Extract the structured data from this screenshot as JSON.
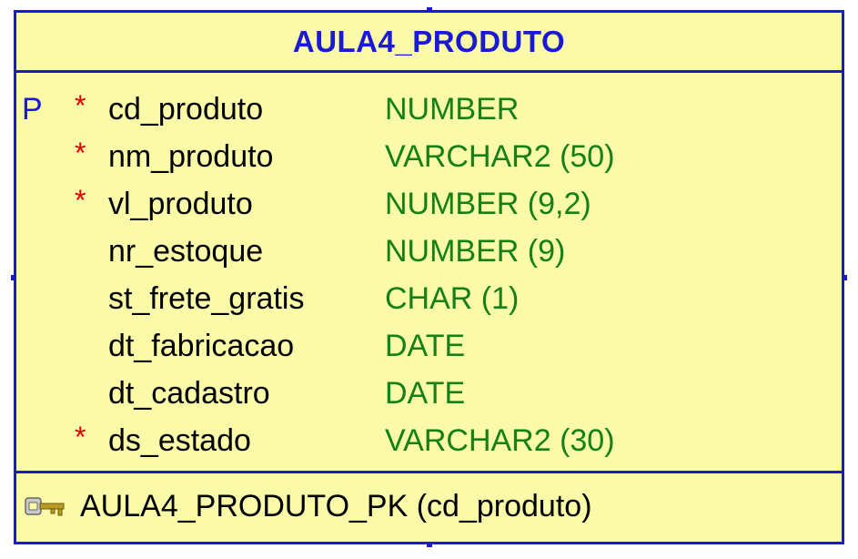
{
  "entity": {
    "name": "AULA4_PRODUTO",
    "columns": [
      {
        "pk": "P",
        "mandatory": "*",
        "name": "cd_produto",
        "type": "NUMBER"
      },
      {
        "pk": "",
        "mandatory": "*",
        "name": "nm_produto",
        "type": "VARCHAR2 (50)"
      },
      {
        "pk": "",
        "mandatory": "*",
        "name": "vl_produto",
        "type": "NUMBER (9,2)"
      },
      {
        "pk": "",
        "mandatory": "",
        "name": "nr_estoque",
        "type": "NUMBER (9)"
      },
      {
        "pk": "",
        "mandatory": "",
        "name": "st_frete_gratis",
        "type": "CHAR (1)"
      },
      {
        "pk": "",
        "mandatory": "",
        "name": "dt_fabricacao",
        "type": "DATE"
      },
      {
        "pk": "",
        "mandatory": "",
        "name": "dt_cadastro",
        "type": "DATE"
      },
      {
        "pk": "",
        "mandatory": "*",
        "name": "ds_estado",
        "type": "VARCHAR2 (30)"
      }
    ],
    "key": {
      "icon": "key-icon",
      "label": "AULA4_PRODUTO_PK (cd_produto)"
    }
  },
  "colors": {
    "border": "#1a1ad6",
    "background": "#fbfaa8",
    "type_text": "#158015",
    "mandatory": "#e00000"
  }
}
